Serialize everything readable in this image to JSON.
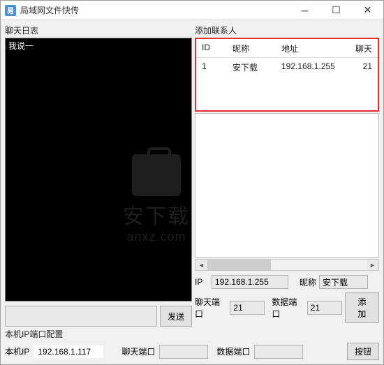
{
  "window": {
    "title": "局域网文件快传",
    "icon_text": "易"
  },
  "chat": {
    "label": "聊天日志",
    "log_text": "我说一",
    "send_label": "发送"
  },
  "contacts": {
    "label": "添加联系人",
    "headers": {
      "id": "ID",
      "nick": "昵称",
      "addr": "地址",
      "chat": "聊天"
    },
    "rows": [
      {
        "id": "1",
        "nick": "安下载",
        "addr": "192.168.1.255",
        "chat": "21"
      }
    ]
  },
  "form": {
    "ip_label": "IP",
    "ip_value": "192.168.1.255",
    "nick_label": "昵称",
    "nick_value": "安下载",
    "chat_port_label": "聊天端口",
    "chat_port_value": "21",
    "data_port_label": "数据端口",
    "data_port_value": "21",
    "add_label": "添加"
  },
  "local": {
    "section_label": "本机IP端口配置",
    "ip_label": "本机IP",
    "ip_value": "192.168.1.117",
    "chat_port_label": "聊天端口",
    "chat_port_value": "",
    "data_port_label": "数据端口",
    "data_port_value": "",
    "button_label": "按钮"
  },
  "watermark": {
    "zh": "安下载",
    "url": "anxz.com"
  }
}
